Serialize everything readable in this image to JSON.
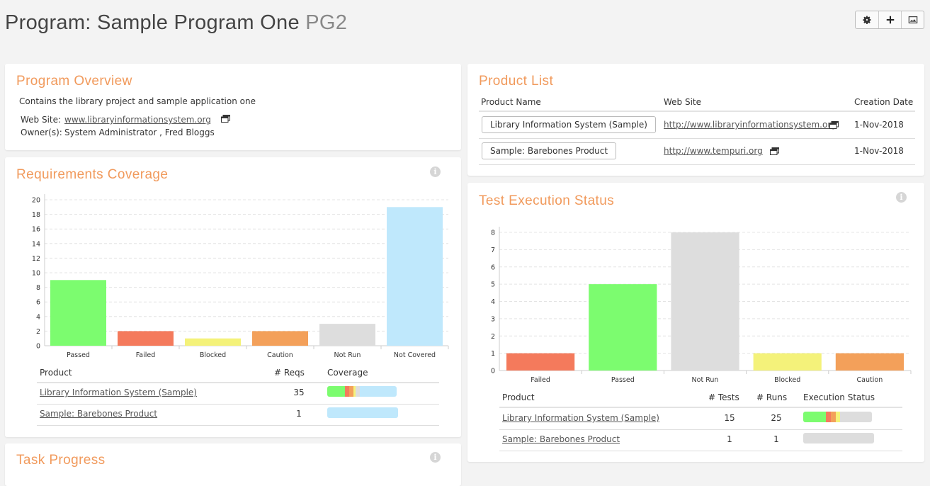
{
  "header": {
    "title": "Program: Sample Program One",
    "token": "PG2",
    "buttons": [
      "gear-icon",
      "plus-icon",
      "image-icon"
    ]
  },
  "overview": {
    "title": "Program Overview",
    "description": "Contains the library project and sample application one",
    "website_label": "Web Site:",
    "website": "www.libraryinformationsystem.org",
    "owners_label": "Owner(s):",
    "owners": "System Administrator , Fred Bloggs"
  },
  "product_list": {
    "title": "Product List",
    "columns": [
      "Product Name",
      "Web Site",
      "Creation Date"
    ],
    "rows": [
      {
        "name": "Library Information System (Sample)",
        "url": "http://www.libraryinformationsystem.org",
        "date": "1-Nov-2018"
      },
      {
        "name": "Sample: Barebones Product",
        "url": "http://www.tempuri.org",
        "date": "1-Nov-2018"
      }
    ]
  },
  "requirements": {
    "title": "Requirements Coverage",
    "columns": [
      "Product",
      "# Reqs",
      "Coverage"
    ],
    "rows": [
      {
        "product": "Library Information System (Sample)",
        "reqs": "35",
        "coverage": [
          {
            "c": "#7cfc6f",
            "v": 0.26
          },
          {
            "c": "#f47a5c",
            "v": 0.06
          },
          {
            "c": "#f3a05a",
            "v": 0.06
          },
          {
            "c": "#f4f27a",
            "v": 0.03
          },
          {
            "c": "#dddddd",
            "v": 0.06
          },
          {
            "c": "#bfe8fc",
            "v": 0.53
          }
        ]
      },
      {
        "product": "Sample: Barebones Product",
        "reqs": "1",
        "coverage": [
          {
            "c": "#bfe8fc",
            "v": 1.0
          }
        ]
      }
    ]
  },
  "test_execution": {
    "title": "Test Execution Status",
    "columns": [
      "Product",
      "# Tests",
      "# Runs",
      "Execution Status"
    ],
    "rows": [
      {
        "product": "Library Information System (Sample)",
        "tests": "15",
        "runs": "25",
        "status": [
          {
            "c": "#7cfc6f",
            "v": 0.33
          },
          {
            "c": "#f47a5c",
            "v": 0.07
          },
          {
            "c": "#f3a05a",
            "v": 0.07
          },
          {
            "c": "#f4f27a",
            "v": 0.07
          },
          {
            "c": "#dddddd",
            "v": 0.46
          }
        ]
      },
      {
        "product": "Sample: Barebones Product",
        "tests": "1",
        "runs": "1",
        "status": [
          {
            "c": "#dddddd",
            "v": 1.0
          }
        ]
      }
    ]
  },
  "task_progress": {
    "title": "Task Progress"
  },
  "chart_data": [
    {
      "type": "bar",
      "categories": [
        "Passed",
        "Failed",
        "Blocked",
        "Caution",
        "Not Run",
        "Not Covered"
      ],
      "values": [
        9,
        2,
        1,
        2,
        3,
        19
      ],
      "colors": [
        "#7cfc6f",
        "#f47a5c",
        "#f4f27a",
        "#f3a05a",
        "#dddddd",
        "#bfe8fc"
      ],
      "yticks": [
        0,
        2,
        4,
        6,
        8,
        10,
        12,
        14,
        16,
        18,
        20
      ],
      "ylim": [
        0,
        20
      ]
    },
    {
      "type": "bar",
      "categories": [
        "Failed",
        "Passed",
        "Not Run",
        "Blocked",
        "Caution"
      ],
      "values": [
        1,
        5,
        8,
        1,
        1
      ],
      "colors": [
        "#f47a5c",
        "#7cfc6f",
        "#dddddd",
        "#f4f27a",
        "#f3a05a"
      ],
      "yticks": [
        0,
        1,
        2,
        3,
        4,
        5,
        6,
        7,
        8
      ],
      "ylim": [
        0,
        8
      ]
    }
  ]
}
